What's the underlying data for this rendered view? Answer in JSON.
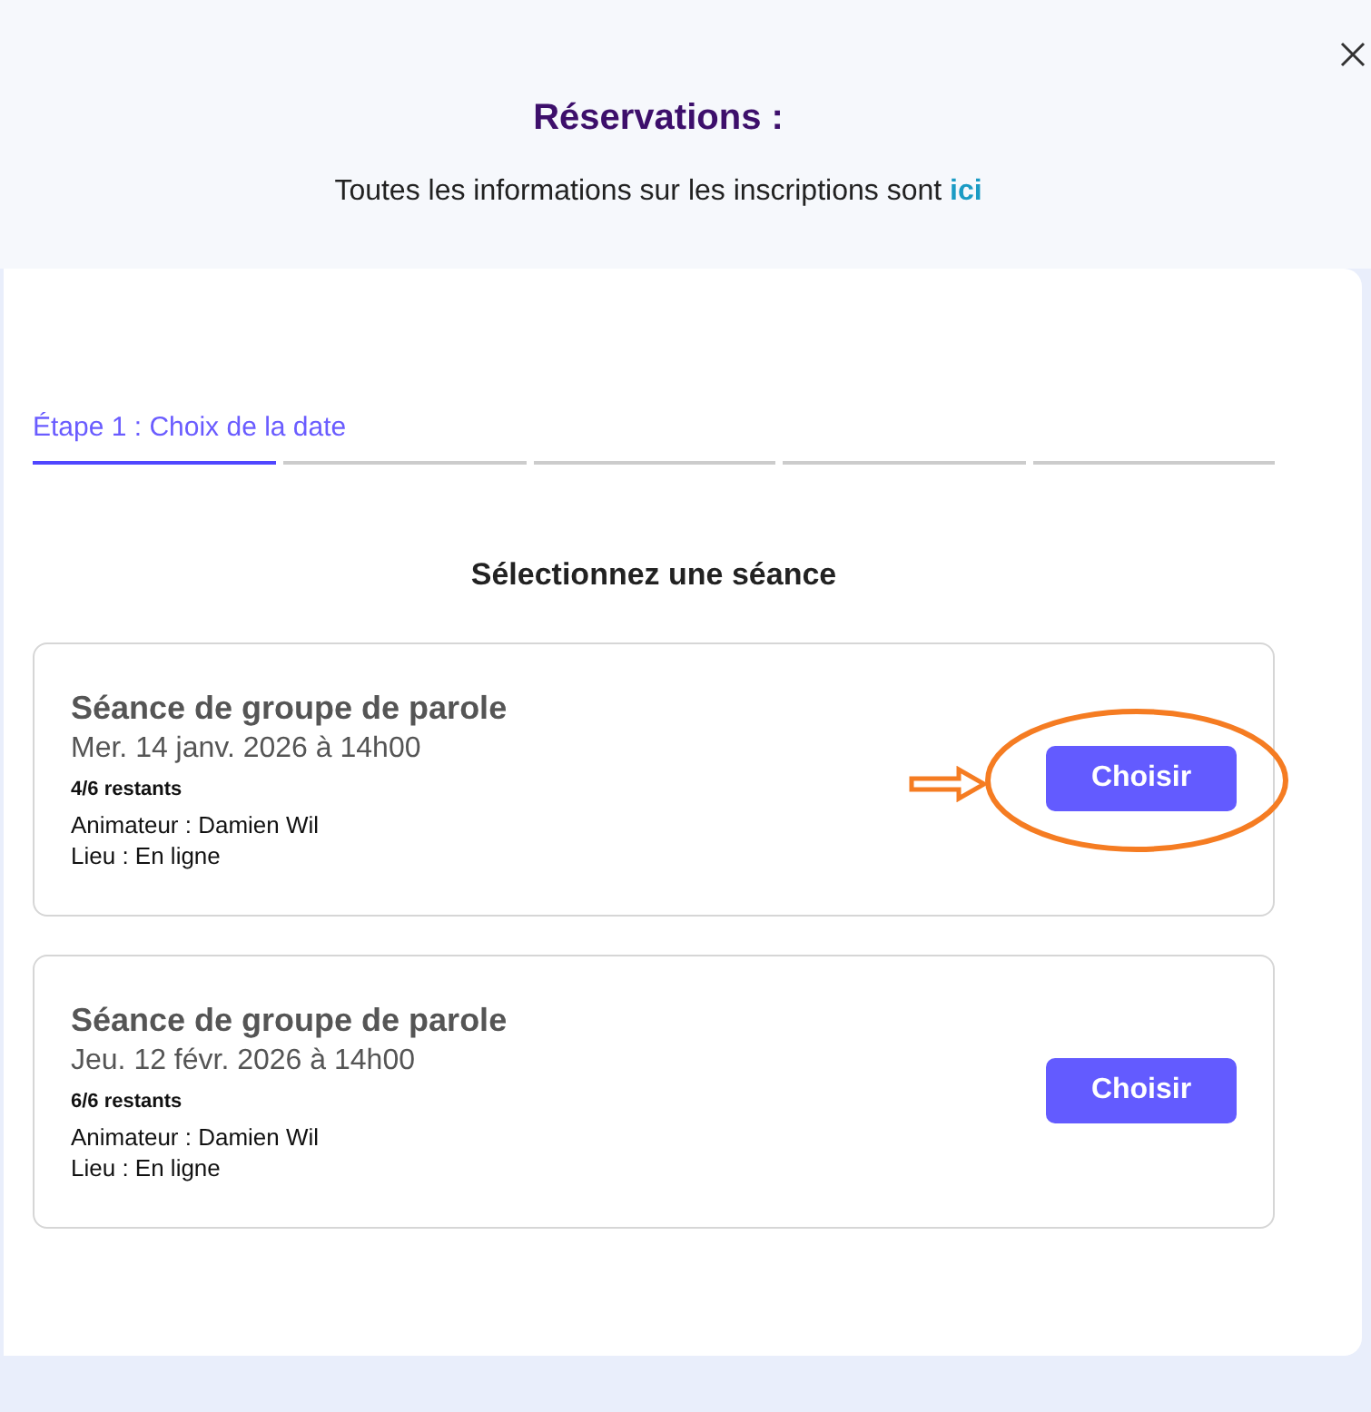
{
  "header": {
    "title": "Réservations :",
    "info_text": "Toutes les informations sur les inscriptions sont ",
    "info_link": "ici"
  },
  "steps": [
    {
      "label": "Étape 1 : Choix de la date",
      "selected": true
    },
    {
      "selected": false
    },
    {
      "selected": false
    },
    {
      "selected": false
    },
    {
      "selected": false
    }
  ],
  "heading": "Sélectionnez une séance",
  "sessions": [
    {
      "title": "Séance de groupe de parole",
      "date": "Mer. 14 janv. 2026 à 14h00",
      "remaining": "4/6 restants",
      "host": "Animateur : Damien Wil",
      "place": "Lieu : En ligne",
      "button": "Choisir",
      "highlighted": true
    },
    {
      "title": "Séance de groupe de parole",
      "date": "Jeu. 12 févr. 2026 à 14h00",
      "remaining": "6/6 restants",
      "host": "Animateur : Damien Wil",
      "place": "Lieu : En ligne",
      "button": "Choisir",
      "highlighted": false
    }
  ]
}
